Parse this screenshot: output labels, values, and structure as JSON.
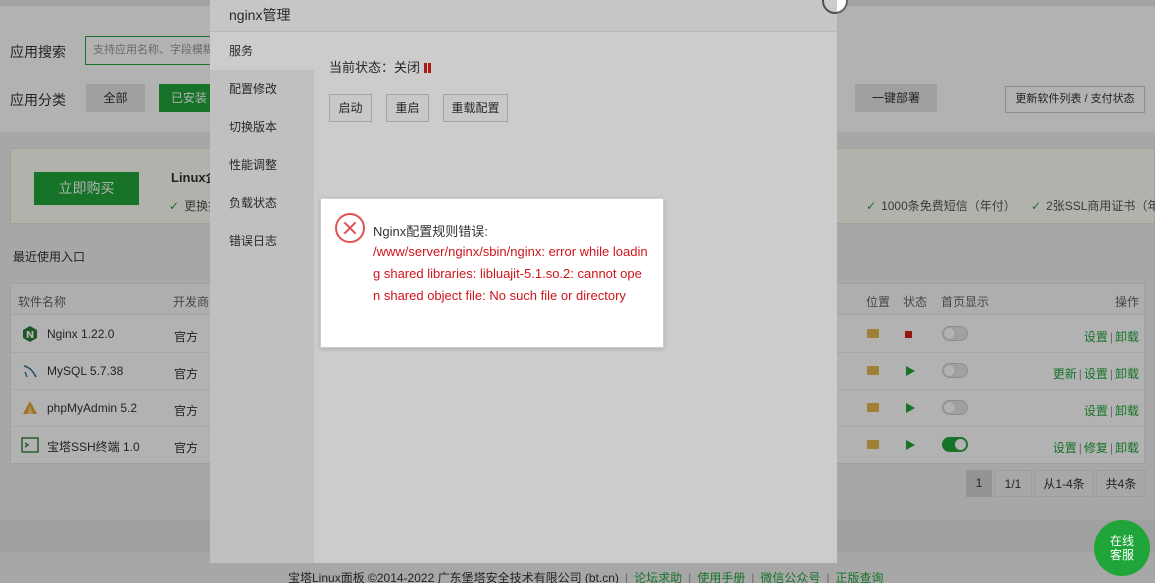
{
  "search": {
    "label": "应用搜索",
    "placeholder": "支持应用名称、字段模糊搜索"
  },
  "category": {
    "label": "应用分类",
    "all": "全部",
    "installed": "已安装"
  },
  "toolbar": {
    "one_click_deploy": "一键部署",
    "update_list": "更新软件列表 / 支付状态"
  },
  "promo": {
    "buy_button": "立即购买",
    "title": "Linux企",
    "feature_left": "更换授",
    "feature_a": "1000条免费短信（年付）",
    "feature_b": "2张SSL商用证书（年"
  },
  "recent_label": "最近使用入口",
  "table": {
    "headers": {
      "name": "软件名称",
      "developer": "开发商",
      "location": "位置",
      "status": "状态",
      "homepage": "首页显示",
      "actions": "操作"
    },
    "rows": [
      {
        "name": "Nginx 1.22.0",
        "developer": "官方",
        "status": "stopped",
        "homepage": false,
        "ops": [
          "设置",
          "卸载"
        ]
      },
      {
        "name": "MySQL 5.7.38",
        "developer": "官方",
        "status": "running",
        "homepage": false,
        "ops": [
          "更新",
          "设置",
          "卸载"
        ]
      },
      {
        "name": "phpMyAdmin 5.2",
        "developer": "官方",
        "status": "running",
        "homepage": false,
        "ops": [
          "设置",
          "卸载"
        ]
      },
      {
        "name": "宝塔SSH终端 1.0",
        "developer": "官方",
        "status": "running",
        "homepage": true,
        "ops": [
          "设置",
          "修复",
          "卸载"
        ]
      }
    ]
  },
  "pager": {
    "current": "1",
    "of": "1/1",
    "range": "从1-4条",
    "total": "共4条"
  },
  "footer": {
    "copyright": "宝塔Linux面板 ©2014-2022 广东堡塔安全技术有限公司 (bt.cn)",
    "links": [
      "论坛求助",
      "使用手册",
      "微信公众号",
      "正版查询"
    ]
  },
  "support": {
    "line1": "在线",
    "line2": "客服"
  },
  "dialog": {
    "title": "nginx管理",
    "menu": [
      "服务",
      "配置修改",
      "切换版本",
      "性能调整",
      "负载状态",
      "错误日志"
    ],
    "status_text": "当前状态：关闭",
    "buttons": {
      "start": "启动",
      "restart": "重启",
      "reload": "重载配置"
    }
  },
  "error": {
    "title": "Nginx配置规则错误:",
    "message": "/www/server/nginx/sbin/nginx: error while loading shared libraries: libluajit-5.1.so.2: cannot open shared object file: No such file or directory"
  },
  "colors": {
    "accent": "#20a53a",
    "error": "#d0141b",
    "stopped": "#d9221c"
  }
}
